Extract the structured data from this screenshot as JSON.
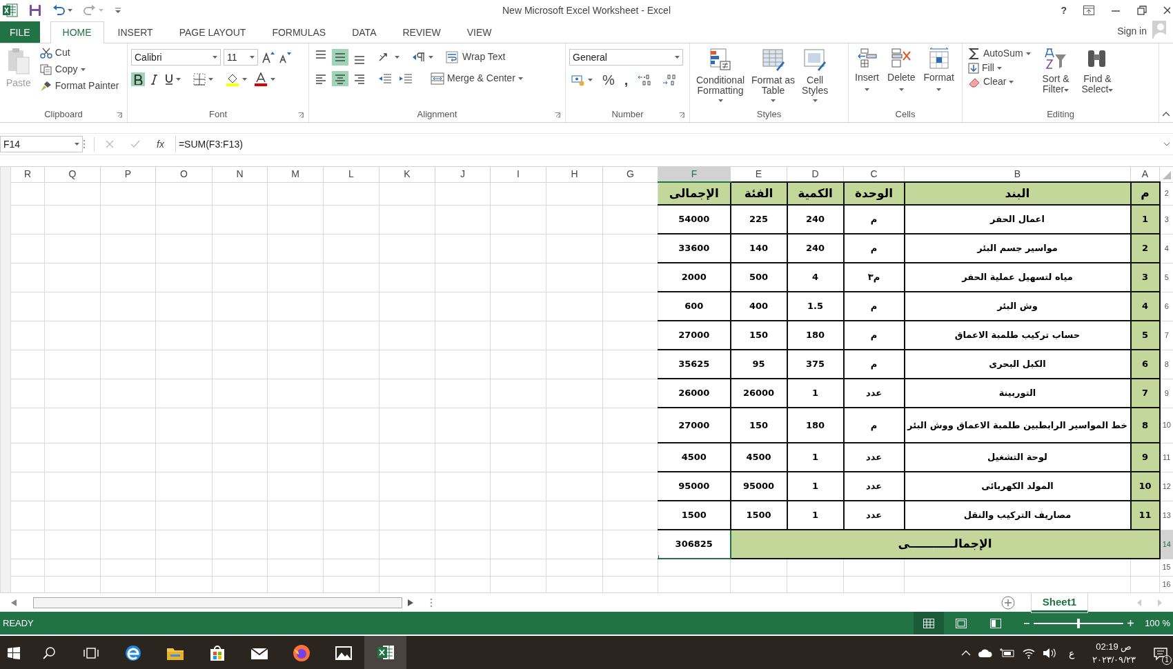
{
  "window": {
    "title": "New Microsoft Excel Worksheet - Excel",
    "help": "?"
  },
  "tabs": [
    {
      "label": "FILE",
      "kind": "file",
      "selected": false
    },
    {
      "label": "HOME",
      "kind": "tab",
      "selected": true
    },
    {
      "label": "INSERT",
      "kind": "tab",
      "selected": false
    },
    {
      "label": "PAGE LAYOUT",
      "kind": "tab",
      "selected": false
    },
    {
      "label": "FORMULAS",
      "kind": "tab",
      "selected": false
    },
    {
      "label": "DATA",
      "kind": "tab",
      "selected": false
    },
    {
      "label": "REVIEW",
      "kind": "tab",
      "selected": false
    },
    {
      "label": "VIEW",
      "kind": "tab",
      "selected": false
    }
  ],
  "account": {
    "sign_in": "Sign in"
  },
  "ribbon": {
    "clipboard": {
      "label": "Clipboard",
      "paste": {
        "label": "Paste",
        "disabled": true
      },
      "cut": "Cut",
      "copy": "Copy",
      "format_painter": "Format Painter"
    },
    "font": {
      "label": "Font",
      "name": "Calibri",
      "size": "11",
      "bold": true,
      "italic": false,
      "underline": false
    },
    "alignment": {
      "label": "Alignment",
      "wrap_text": "Wrap Text",
      "merge_center": "Merge & Center",
      "vertical": [
        {
          "kind": "top",
          "selected": false
        },
        {
          "kind": "middle",
          "selected": true
        },
        {
          "kind": "bottom",
          "selected": false
        }
      ],
      "horizontal": [
        {
          "kind": "left",
          "selected": false
        },
        {
          "kind": "center",
          "selected": true
        },
        {
          "kind": "right",
          "selected": false
        }
      ]
    },
    "number": {
      "label": "Number",
      "format": "General",
      "percent": "%",
      "comma": ","
    },
    "styles": {
      "label": "Styles",
      "buttons": [
        {
          "kind": "conditional",
          "label": "Conditional\nFormatting"
        },
        {
          "kind": "table",
          "label": "Format as\nTable"
        },
        {
          "kind": "cellstyles",
          "label": "Cell\nStyles"
        }
      ]
    },
    "cells": {
      "label": "Cells",
      "buttons": [
        {
          "kind": "insert",
          "label": "Insert"
        },
        {
          "kind": "delete",
          "label": "Delete"
        },
        {
          "kind": "format",
          "label": "Format"
        }
      ]
    },
    "editing": {
      "label": "Editing",
      "autosum": "AutoSum",
      "fill": "Fill",
      "clear": "Clear",
      "sort": "Sort &\nFilter",
      "find": "Find &\nSelect"
    }
  },
  "formula_bar": {
    "name_box": "F14",
    "function_label": "fx",
    "formula": "=SUM(F3:F13)"
  },
  "sheet": {
    "columns": [
      {
        "label": "R",
        "selected": false
      },
      {
        "label": "Q",
        "selected": false
      },
      {
        "label": "P",
        "selected": false
      },
      {
        "label": "O",
        "selected": false
      },
      {
        "label": "N",
        "selected": false
      },
      {
        "label": "M",
        "selected": false
      },
      {
        "label": "L",
        "selected": false
      },
      {
        "label": "K",
        "selected": false
      },
      {
        "label": "J",
        "selected": false
      },
      {
        "label": "I",
        "selected": false
      },
      {
        "label": "H",
        "selected": false
      },
      {
        "label": "G",
        "selected": false
      },
      {
        "label": "F",
        "selected": true
      },
      {
        "label": "E",
        "selected": false
      },
      {
        "label": "D",
        "selected": false
      },
      {
        "label": "C",
        "selected": false
      },
      {
        "label": "B",
        "selected": false
      },
      {
        "label": "A",
        "selected": false
      }
    ],
    "row_numbers": [
      {
        "label": "2",
        "selected": false
      },
      {
        "label": "3",
        "selected": false
      },
      {
        "label": "4",
        "selected": false
      },
      {
        "label": "5",
        "selected": false
      },
      {
        "label": "6",
        "selected": false
      },
      {
        "label": "7",
        "selected": false
      },
      {
        "label": "8",
        "selected": false
      },
      {
        "label": "9",
        "selected": false
      },
      {
        "label": "10",
        "selected": false
      },
      {
        "label": "11",
        "selected": false
      },
      {
        "label": "12",
        "selected": false
      },
      {
        "label": "13",
        "selected": false
      },
      {
        "label": "14",
        "selected": true
      },
      {
        "label": "15",
        "selected": false
      },
      {
        "label": "16",
        "selected": false
      }
    ],
    "header": {
      "A": "م",
      "B": "البند",
      "C": "الوحدة",
      "D": "الكمية",
      "E": "الفئة",
      "F": "الإجمالى"
    },
    "rows": [
      {
        "A": "1",
        "B": "اعمال الحفر",
        "C": "م",
        "D": "240",
        "E": "225",
        "F": "54000"
      },
      {
        "A": "2",
        "B": "مواسير جسم البئر",
        "C": "م",
        "D": "240",
        "E": "140",
        "F": "33600"
      },
      {
        "A": "3",
        "B": "مياه لتسهيل عملية الحفر",
        "C": "م٣",
        "D": "4",
        "E": "500",
        "F": "2000"
      },
      {
        "A": "4",
        "B": "وش البئر",
        "C": "م",
        "D": "1.5",
        "E": "400",
        "F": "600"
      },
      {
        "A": "5",
        "B": "حساب تركيب طلمبة الاعماق",
        "C": "م",
        "D": "180",
        "E": "150",
        "F": "27000"
      },
      {
        "A": "6",
        "B": "الكبل البحرى",
        "C": "م",
        "D": "375",
        "E": "95",
        "F": "35625"
      },
      {
        "A": "7",
        "B": "التوربينة",
        "C": "عدد",
        "D": "1",
        "E": "26000",
        "F": "26000"
      },
      {
        "A": "8",
        "B": "خط المواسير الرابطبين طلمبة الاعماق ووش البئر",
        "C": "م",
        "D": "180",
        "E": "150",
        "F": "27000"
      },
      {
        "A": "9",
        "B": "لوحة التشغيل",
        "C": "عدد",
        "D": "1",
        "E": "4500",
        "F": "4500"
      },
      {
        "A": "10",
        "B": "المولد الكهربائى",
        "C": "عدد",
        "D": "1",
        "E": "95000",
        "F": "95000"
      },
      {
        "A": "11",
        "B": "مصاريف التركيب والنقل",
        "C": "عدد",
        "D": "1",
        "E": "1500",
        "F": "1500"
      }
    ],
    "total": {
      "value": "306825",
      "selected": true,
      "label": "الإجمالـــــــــــى"
    }
  },
  "sheet_tabs": [
    {
      "label": "Sheet1",
      "selected": true
    }
  ],
  "status_bar": {
    "status": "READY",
    "zoom": "100 %",
    "zoom_level": {
      "level": 0.5
    }
  },
  "taskbar": {
    "language": "ع",
    "time": "ص 02:19",
    "date": "٢٠٢٣/٠٩/٢٣",
    "notification_count": "1"
  }
}
